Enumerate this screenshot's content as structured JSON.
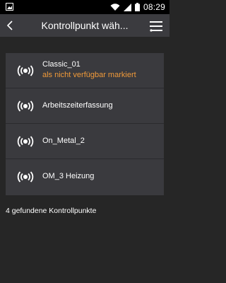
{
  "status": {
    "time": "08:29",
    "left_icon": "notification-image-icon",
    "icons": [
      "wifi-icon",
      "signal-icon",
      "battery-icon"
    ]
  },
  "header": {
    "title": "Kontrollpunkt wäh...",
    "back_icon": "back-chevron-icon",
    "menu_icon": "filter-menu-icon"
  },
  "list": {
    "items": [
      {
        "label": "Classic_01",
        "status": "als nicht verfügbar markiert",
        "icon": "broadcast-icon"
      },
      {
        "label": "Arbeitszeiterfassung",
        "icon": "broadcast-icon"
      },
      {
        "label": "On_Metal_2",
        "icon": "broadcast-icon"
      },
      {
        "label": "OM_3 Heizung",
        "icon": "broadcast-icon"
      }
    ]
  },
  "footer": {
    "count_text": "4 gefundene Kontrollpunkte"
  },
  "colors": {
    "background": "#262626",
    "appbar": "#3b3b3f",
    "list_background": "#3a3a3e",
    "status_warning": "#f09a3a"
  }
}
